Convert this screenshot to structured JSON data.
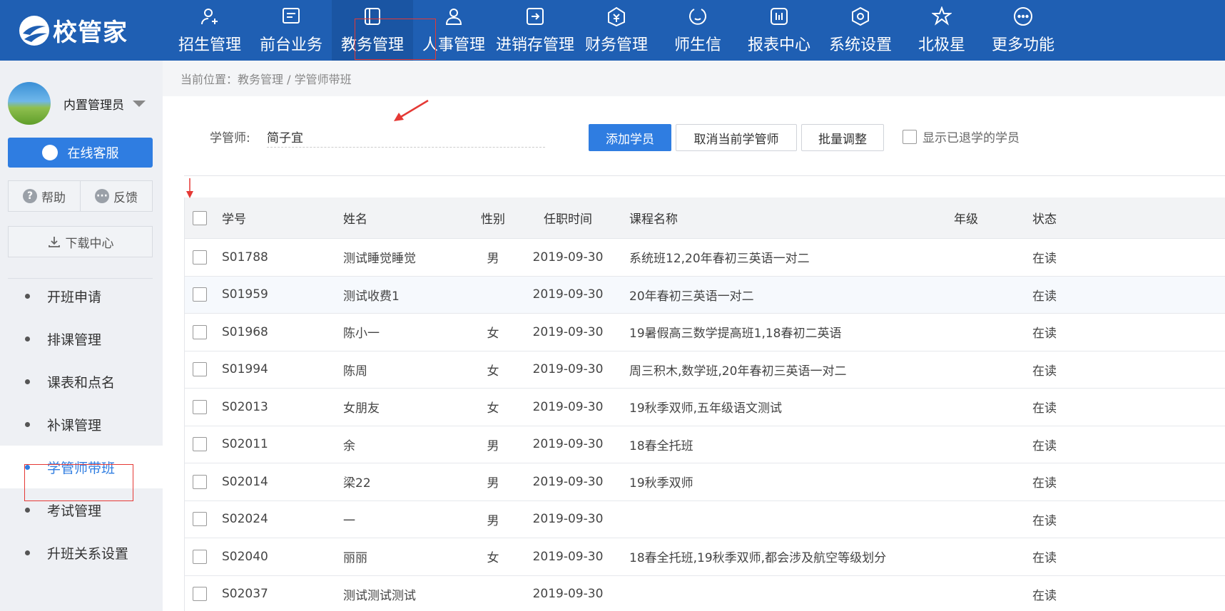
{
  "app": {
    "logo_text": "校管家"
  },
  "nav": [
    {
      "label": "招生管理",
      "icon": "user-add-icon"
    },
    {
      "label": "前台业务",
      "icon": "reception-icon"
    },
    {
      "label": "教务管理",
      "icon": "academic-icon",
      "active": true
    },
    {
      "label": "人事管理",
      "icon": "person-icon"
    },
    {
      "label": "进销存管理",
      "icon": "inventory-icon"
    },
    {
      "label": "财务管理",
      "icon": "finance-icon"
    },
    {
      "label": "师生信",
      "icon": "message-icon"
    },
    {
      "label": "报表中心",
      "icon": "report-icon"
    },
    {
      "label": "系统设置",
      "icon": "settings-icon"
    },
    {
      "label": "北极星",
      "icon": "star-icon"
    },
    {
      "label": "更多功能",
      "icon": "more-icon"
    }
  ],
  "sidebar": {
    "user_name": "内置管理员",
    "service_label": "在线客服",
    "help_label": "帮助",
    "feedback_label": "反馈",
    "download_label": "下载中心",
    "menu": [
      {
        "label": "开班申请"
      },
      {
        "label": "排课管理"
      },
      {
        "label": "课表和点名"
      },
      {
        "label": "补课管理"
      },
      {
        "label": "学管师带班",
        "active": true
      },
      {
        "label": "考试管理"
      },
      {
        "label": "升班关系设置"
      }
    ]
  },
  "breadcrumb": "当前位置：教务管理 / 学管师带班",
  "filter": {
    "label": "学管师:",
    "value": "简子宜",
    "add_button": "添加学员",
    "cancel_button": "取消当前学管师",
    "batch_button": "批量调整",
    "show_quit_label": "显示已退学的学员"
  },
  "table": {
    "headers": {
      "no": "学号",
      "name": "姓名",
      "sex": "性别",
      "date": "任职时间",
      "course": "课程名称",
      "grade": "年级",
      "status": "状态"
    },
    "rows": [
      {
        "no": "S01788",
        "name": "测试睡觉睡觉",
        "sex": "男",
        "date": "2019-09-30",
        "course": "系统班12,20年春初三英语一对二",
        "grade": "",
        "status": "在读"
      },
      {
        "no": "S01959",
        "name": "测试收费1",
        "sex": "",
        "date": "2019-09-30",
        "course": "20年春初三英语一对二",
        "grade": "",
        "status": "在读"
      },
      {
        "no": "S01968",
        "name": "陈小一",
        "sex": "女",
        "date": "2019-09-30",
        "course": "19暑假高三数学提高班1,18春初二英语",
        "grade": "",
        "status": "在读"
      },
      {
        "no": "S01994",
        "name": "陈周",
        "sex": "女",
        "date": "2019-09-30",
        "course": "周三积木,数学班,20年春初三英语一对二",
        "grade": "",
        "status": "在读"
      },
      {
        "no": "S02013",
        "name": "女朋友",
        "sex": "女",
        "date": "2019-09-30",
        "course": "19秋季双师,五年级语文测试",
        "grade": "",
        "status": "在读"
      },
      {
        "no": "S02011",
        "name": "余",
        "sex": "男",
        "date": "2019-09-30",
        "course": "18春全托班",
        "grade": "",
        "status": "在读"
      },
      {
        "no": "S02014",
        "name": "梁22",
        "sex": "男",
        "date": "2019-09-30",
        "course": "19秋季双师",
        "grade": "",
        "status": "在读"
      },
      {
        "no": "S02024",
        "name": "一",
        "sex": "男",
        "date": "2019-09-30",
        "course": "",
        "grade": "",
        "status": "在读"
      },
      {
        "no": "S02040",
        "name": "丽丽",
        "sex": "女",
        "date": "2019-09-30",
        "course": "18春全托班,19秋季双师,都会涉及航空等级划分",
        "grade": "",
        "status": "在读"
      },
      {
        "no": "S02037",
        "name": "测试测试测试",
        "sex": "",
        "date": "2019-09-30",
        "course": "",
        "grade": "",
        "status": "在读"
      }
    ]
  },
  "colors": {
    "brand": "#1f5fb3",
    "accent": "#2f7de1",
    "annotation": "#e53935"
  }
}
